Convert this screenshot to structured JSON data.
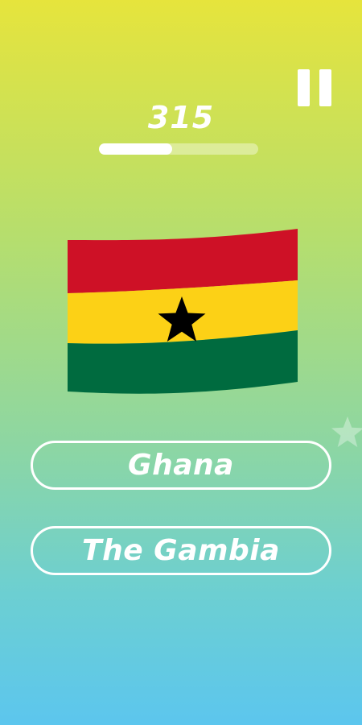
{
  "score": "315",
  "progress": 0.46,
  "flag": {
    "country": "Ghana",
    "colors": {
      "red": "#ce1126",
      "gold": "#fcd116",
      "green": "#006b3f",
      "star": "#000000"
    }
  },
  "answers": [
    {
      "label": "Ghana"
    },
    {
      "label": "The Gambia"
    }
  ],
  "icons": {
    "pause": "pause-icon",
    "decor": "star-icon"
  }
}
